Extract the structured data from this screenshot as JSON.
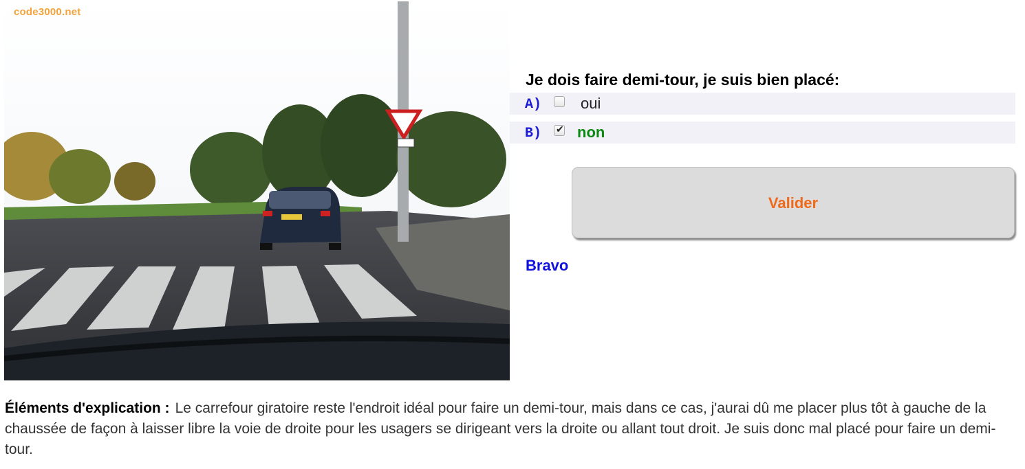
{
  "site": {
    "watermark": "code3000.net"
  },
  "question": {
    "text": "Je dois faire demi-tour, je suis bien placé:"
  },
  "answers": [
    {
      "letter": "A)",
      "label": "oui",
      "checked": false
    },
    {
      "letter": "B)",
      "label": "non",
      "checked": true
    }
  ],
  "actions": {
    "validate_label": "Valider"
  },
  "feedback": {
    "result": "Bravo"
  },
  "explanation": {
    "heading": "Éléments d'explication :",
    "text": "Le carrefour giratoire reste l'endroit idéal pour faire un demi-tour, mais dans ce cas, j'aurai dû me placer plus tôt à gauche de la chaussée de façon à laisser libre la voie de droite pour les usagers se dirigeant vers la droite ou allant tout droit. Je suis donc mal placé pour faire un demi-tour."
  },
  "colors": {
    "question": "#000000",
    "answer_letter": "#1a1ad6",
    "correct_answer": "#0a8a10",
    "button_text": "#f06a1a",
    "feedback": "#1111dd",
    "watermark": "#f5a23a"
  }
}
